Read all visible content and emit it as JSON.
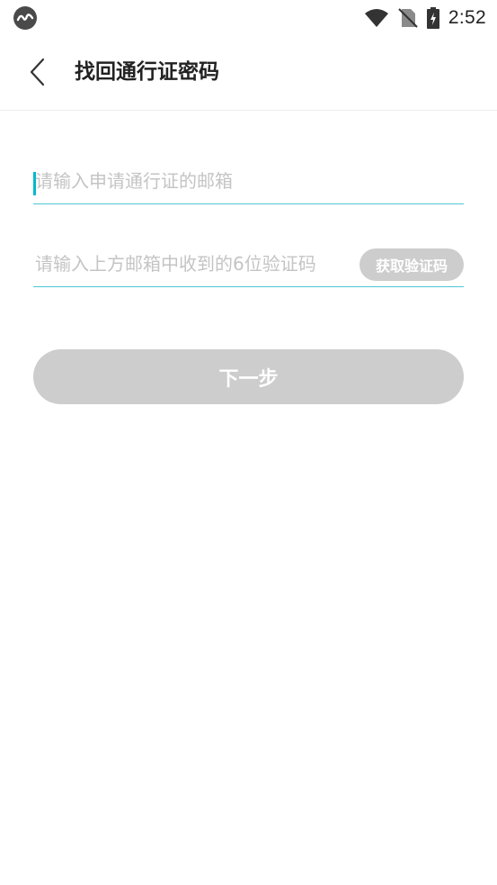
{
  "status_bar": {
    "app_icon": "app-notification-icon",
    "icons": [
      "wifi-icon",
      "no-sim-icon",
      "battery-charging-icon"
    ],
    "time": "2:52"
  },
  "header": {
    "back_icon": "chevron-left-icon",
    "title": "找回通行证密码"
  },
  "form": {
    "email_placeholder": "请输入申请通行证的邮箱",
    "email_value": "",
    "code_placeholder": "请输入上方邮箱中收到的6位验证码",
    "code_value": "",
    "get_code_label": "获取验证码",
    "next_label": "下一步"
  },
  "colors": {
    "accent": "#00b9cc",
    "underline": "#4fc7d5",
    "disabled_button": "#cdcdcd",
    "title_text": "#222222",
    "placeholder": "#c4c4c4"
  }
}
